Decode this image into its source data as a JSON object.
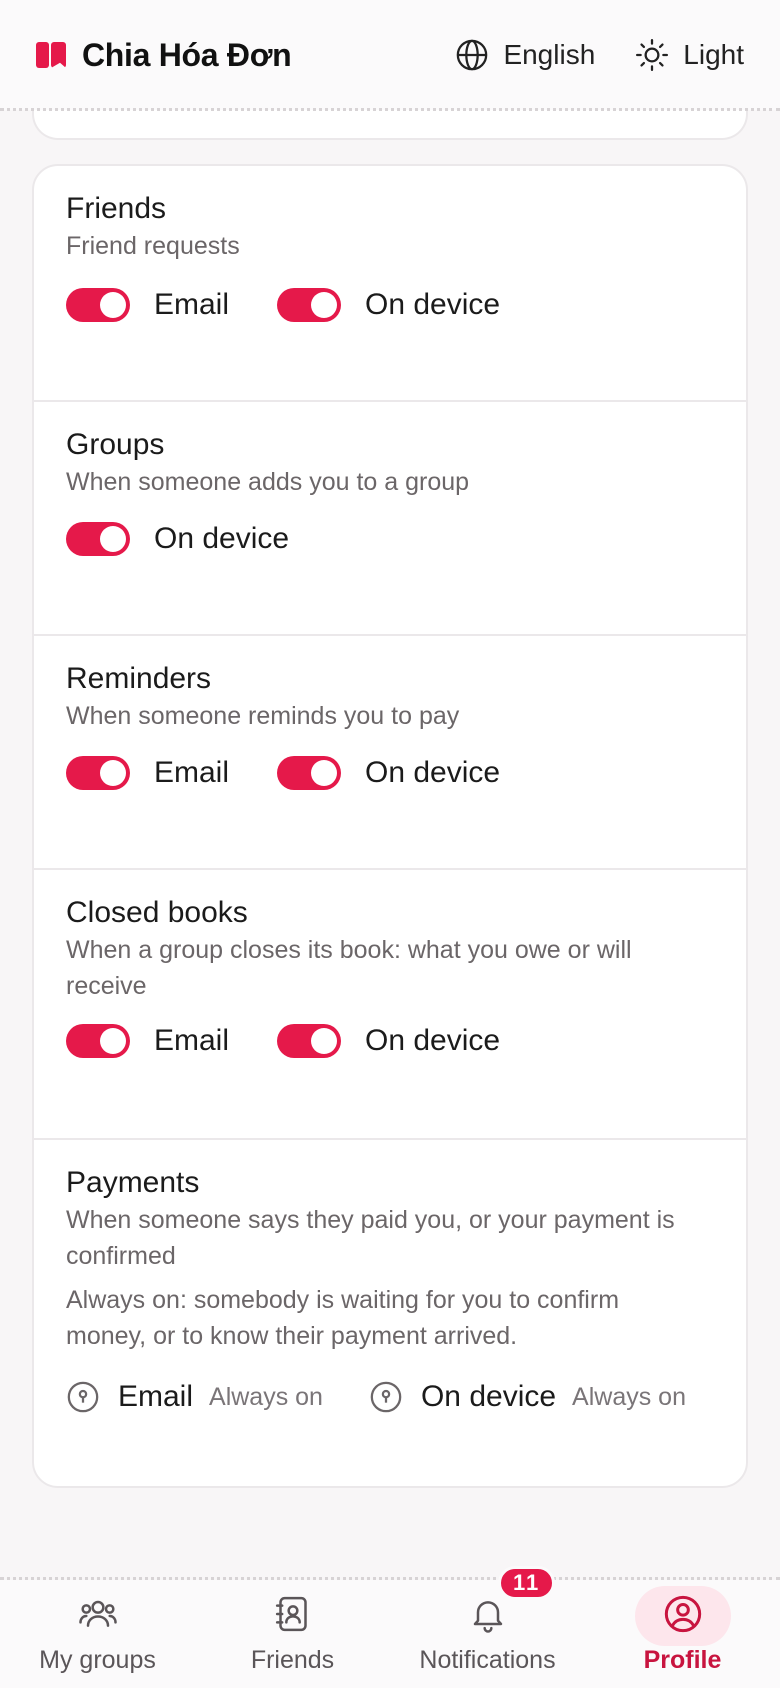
{
  "header": {
    "app_name": "Chia Hóa Đơn",
    "language": "English",
    "theme": "Light"
  },
  "sections": {
    "friends": {
      "title": "Friends",
      "desc": "Friend requests",
      "email_label": "Email",
      "device_label": "On device",
      "email_on": true,
      "device_on": true
    },
    "groups": {
      "title": "Groups",
      "desc": "When someone adds you to a group",
      "device_label": "On device",
      "device_on": true
    },
    "reminders": {
      "title": "Reminders",
      "desc": "When someone reminds you to pay",
      "email_label": "Email",
      "device_label": "On device",
      "email_on": true,
      "device_on": true
    },
    "closed_books": {
      "title": "Closed books",
      "desc": "When a group closes its book: what you owe or will receive",
      "email_label": "Email",
      "device_label": "On device",
      "email_on": true,
      "device_on": true
    },
    "payments": {
      "title": "Payments",
      "desc": "When someone says they paid you, or your payment is confirmed",
      "note": "Always on: somebody is waiting for you to confirm money, or to know their payment arrived.",
      "email_label": "Email",
      "device_label": "On device",
      "always_on": "Always on"
    }
  },
  "nav": {
    "groups": "My groups",
    "friends": "Friends",
    "notifications": "Notifications",
    "notifications_badge": "11",
    "profile": "Profile"
  },
  "colors": {
    "accent": "#e5194a",
    "active_nav": "#c8143f"
  }
}
